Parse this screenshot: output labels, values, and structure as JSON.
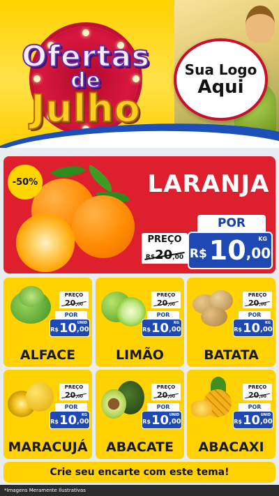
{
  "header": {
    "title_line1": "Ofertas",
    "title_line2": "de",
    "title_line3": "Julho",
    "logo_line1": "Sua Logo",
    "logo_line2": "Aqui"
  },
  "featured": {
    "discount": "-50%",
    "name": "LARANJA",
    "preco_label": "PREÇO",
    "old_price_int": "20",
    "old_price_dec": ",00",
    "old_price_currency": "R$",
    "por_label": "POR",
    "currency": "R$",
    "price_int": "10",
    "price_dec": ",00",
    "unit": "KG"
  },
  "products": [
    {
      "name": "ALFACE",
      "preco_label": "PREÇO",
      "old_price": "20",
      "old_dec": ",00",
      "por_label": "POR",
      "currency": "R$",
      "price_int": "10",
      "price_dec": ",00",
      "unit": "UNID"
    },
    {
      "name": "LIMÃO",
      "preco_label": "PREÇO",
      "old_price": "20",
      "old_dec": ",00",
      "por_label": "POR",
      "currency": "R$",
      "price_int": "10",
      "price_dec": ",00",
      "unit": "KG"
    },
    {
      "name": "BATATA",
      "preco_label": "PREÇO",
      "old_price": "20",
      "old_dec": ",00",
      "por_label": "POR",
      "currency": "R$",
      "price_int": "10",
      "price_dec": ",00",
      "unit": "KG"
    },
    {
      "name": "MARACUJÁ",
      "preco_label": "PREÇO",
      "old_price": "20",
      "old_dec": ",00",
      "por_label": "POR",
      "currency": "R$",
      "price_int": "10",
      "price_dec": ",00",
      "unit": "KG"
    },
    {
      "name": "ABACATE",
      "preco_label": "PREÇO",
      "old_price": "20",
      "old_dec": ",00",
      "por_label": "POR",
      "currency": "R$",
      "price_int": "10",
      "price_dec": ",00",
      "unit": "UNID"
    },
    {
      "name": "ABACAXI",
      "preco_label": "PREÇO",
      "old_price": "20",
      "old_dec": ",00",
      "por_label": "POR",
      "currency": "R$",
      "price_int": "10",
      "price_dec": ",00",
      "unit": "UNID"
    }
  ],
  "footer": {
    "cta": "Crie seu encarte com este tema!",
    "disclaimer": "*Imagens Meramente Ilustrativas"
  },
  "colors": {
    "yellow": "#ffd200",
    "red": "#de1f2e",
    "blue": "#1e49b5",
    "purple_title": "#6a2aa8",
    "gold_title": "#ffcf1f"
  },
  "icons": [
    "orange-icon",
    "lettuce-icon",
    "lime-icon",
    "potato-icon",
    "passion-fruit-icon",
    "avocado-icon",
    "pineapple-icon"
  ]
}
